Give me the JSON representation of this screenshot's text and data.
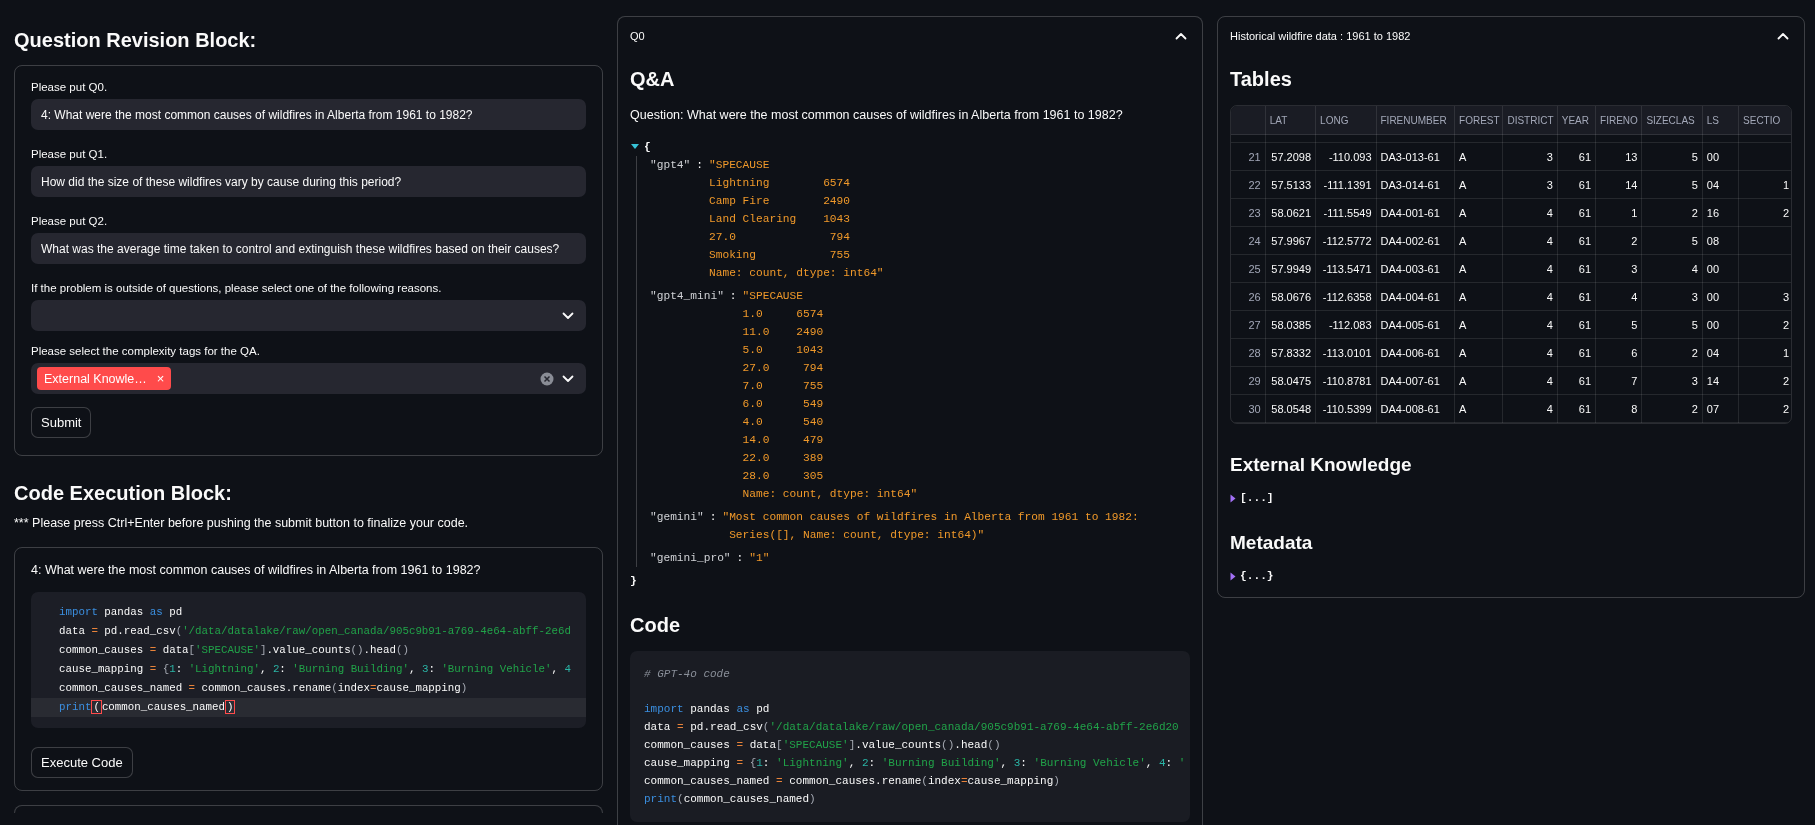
{
  "question_revision": {
    "heading": "Question Revision Block:",
    "questions": [
      {
        "label": "Please put Q0.",
        "value": "4: What were the most common causes of wildfires in Alberta from 1961 to 1982?"
      },
      {
        "label": "Please put Q1.",
        "value": "How did the size of these wildfires vary by cause during this period?"
      },
      {
        "label": "Please put Q2.",
        "value": "What was the average time taken to control and extinguish these wildfires based on their causes?"
      }
    ],
    "reason_select": {
      "label": "If the problem is outside of questions, please select one of the following reasons."
    },
    "complexity_tags": {
      "label": "Please select the complexity tags for the QA.",
      "tags": [
        {
          "text": "External Knowle…",
          "remove": "×"
        }
      ]
    },
    "submit_button": "Submit"
  },
  "code_execution": {
    "heading": "Code Execution Block:",
    "note": "*** Please press Ctrl+Enter before pushing the submit button to finalize your code.",
    "question": "4: What were the most common causes of wildfires in Alberta from 1961 to 1982?",
    "code_lines": [
      {
        "active": false,
        "tokens": [
          {
            "kind": "keyword",
            "text": "import"
          },
          {
            "kind": "plain",
            "text": " pandas "
          },
          {
            "kind": "keyword",
            "text": "as"
          },
          {
            "kind": "plain",
            "text": " pd"
          }
        ]
      },
      {
        "active": false,
        "tokens": [
          {
            "kind": "plain",
            "text": "data "
          },
          {
            "kind": "operator",
            "text": "="
          },
          {
            "kind": "plain",
            "text": " pd.read_csv"
          },
          {
            "kind": "punct",
            "text": "("
          },
          {
            "kind": "string",
            "text": "'/data/datalake/raw/open_canada/905c9b91-a769-4e64-abff-2e6d"
          }
        ]
      },
      {
        "active": false,
        "tokens": [
          {
            "kind": "plain",
            "text": "common_causes "
          },
          {
            "kind": "operator",
            "text": "="
          },
          {
            "kind": "plain",
            "text": " data"
          },
          {
            "kind": "punct",
            "text": "["
          },
          {
            "kind": "string",
            "text": "'SPECAUSE'"
          },
          {
            "kind": "punct",
            "text": "]"
          },
          {
            "kind": "plain",
            "text": ".value_counts"
          },
          {
            "kind": "punct",
            "text": "()"
          },
          {
            "kind": "plain",
            "text": ".head"
          },
          {
            "kind": "punct",
            "text": "()"
          }
        ]
      },
      {
        "active": false,
        "tokens": [
          {
            "kind": "plain",
            "text": "cause_mapping "
          },
          {
            "kind": "operator",
            "text": "= "
          },
          {
            "kind": "punct",
            "text": "{"
          },
          {
            "kind": "number",
            "text": "1"
          },
          {
            "kind": "plain",
            "text": ": "
          },
          {
            "kind": "string",
            "text": "'Lightning'"
          },
          {
            "kind": "plain",
            "text": ", "
          },
          {
            "kind": "number",
            "text": "2"
          },
          {
            "kind": "plain",
            "text": ": "
          },
          {
            "kind": "string",
            "text": "'Burning Building'"
          },
          {
            "kind": "plain",
            "text": ", "
          },
          {
            "kind": "number",
            "text": "3"
          },
          {
            "kind": "plain",
            "text": ": "
          },
          {
            "kind": "string",
            "text": "'Burning Vehicle'"
          },
          {
            "kind": "plain",
            "text": ", "
          },
          {
            "kind": "number",
            "text": "4"
          }
        ]
      },
      {
        "active": false,
        "tokens": [
          {
            "kind": "plain",
            "text": "common_causes_named "
          },
          {
            "kind": "operator",
            "text": "="
          },
          {
            "kind": "plain",
            "text": " common_causes.rename"
          },
          {
            "kind": "punct",
            "text": "("
          },
          {
            "kind": "plain",
            "text": "index"
          },
          {
            "kind": "operator",
            "text": "="
          },
          {
            "kind": "plain",
            "text": "cause_mapping"
          },
          {
            "kind": "punct",
            "text": ")"
          }
        ]
      },
      {
        "active": true,
        "tokens": [
          {
            "kind": "keyword",
            "text": "print"
          },
          {
            "kind": "bracket-match",
            "text": "("
          },
          {
            "kind": "plain",
            "text": "common_causes_named"
          },
          {
            "kind": "bracket-match",
            "text": ")"
          }
        ]
      }
    ],
    "execute_button": "Execute Code"
  },
  "qa_panel": {
    "header": "Q0",
    "expanded": true,
    "title": "Q&A",
    "question": "Question: What were the most common causes of wildfires in Alberta from 1961 to 1982?",
    "answers": {
      "expanded": true,
      "open": "{",
      "close": "}",
      "entries": [
        {
          "key": "\"gpt4\"",
          "separator": ":",
          "value": "\"SPECAUSE\nLightning        6574\nCamp Fire        2490\nLand Clearing    1043\n27.0              794\nSmoking           755\nName: count, dtype: int64\""
        },
        {
          "key": "\"gpt4_mini\"",
          "separator": ":",
          "value": "\"SPECAUSE\n1.0     6574\n11.0    2490\n5.0     1043\n27.0     794\n7.0      755\n6.0      549\n4.0      540\n14.0     479\n22.0     389\n28.0     305\nName: count, dtype: int64\""
        },
        {
          "key": "\"gemini\"",
          "separator": ":",
          "value": "\"Most common causes of wildfires in Alberta from 1961 to 1982:\n Series([], Name: count, dtype: int64)\""
        },
        {
          "key": "\"gemini_pro\"",
          "separator": ":",
          "value": "\"1\""
        }
      ]
    },
    "code_title": "Code",
    "code_comment": "# GPT-4o code",
    "code_lines": [
      {
        "tokens": [
          {
            "kind": "keyword",
            "text": "import"
          },
          {
            "kind": "plain",
            "text": " pandas "
          },
          {
            "kind": "keyword",
            "text": "as"
          },
          {
            "kind": "plain",
            "text": " pd"
          }
        ]
      },
      {
        "tokens": [
          {
            "kind": "plain",
            "text": "data "
          },
          {
            "kind": "operator",
            "text": "="
          },
          {
            "kind": "plain",
            "text": " pd.read_csv"
          },
          {
            "kind": "punct",
            "text": "("
          },
          {
            "kind": "string",
            "text": "'/data/datalake/raw/open_canada/905c9b91-a769-4e64-abff-2e6d20"
          }
        ]
      },
      {
        "tokens": [
          {
            "kind": "plain",
            "text": "common_causes "
          },
          {
            "kind": "operator",
            "text": "="
          },
          {
            "kind": "plain",
            "text": " data"
          },
          {
            "kind": "punct",
            "text": "["
          },
          {
            "kind": "string",
            "text": "'SPECAUSE'"
          },
          {
            "kind": "punct",
            "text": "]"
          },
          {
            "kind": "plain",
            "text": ".value_counts"
          },
          {
            "kind": "punct",
            "text": "()"
          },
          {
            "kind": "plain",
            "text": ".head"
          },
          {
            "kind": "punct",
            "text": "()"
          }
        ]
      },
      {
        "tokens": [
          {
            "kind": "plain",
            "text": "cause_mapping "
          },
          {
            "kind": "operator",
            "text": "= "
          },
          {
            "kind": "punct",
            "text": "{"
          },
          {
            "kind": "number",
            "text": "1"
          },
          {
            "kind": "plain",
            "text": ": "
          },
          {
            "kind": "string",
            "text": "'Lightning'"
          },
          {
            "kind": "plain",
            "text": ", "
          },
          {
            "kind": "number",
            "text": "2"
          },
          {
            "kind": "plain",
            "text": ": "
          },
          {
            "kind": "string",
            "text": "'Burning Building'"
          },
          {
            "kind": "plain",
            "text": ", "
          },
          {
            "kind": "number",
            "text": "3"
          },
          {
            "kind": "plain",
            "text": ": "
          },
          {
            "kind": "string",
            "text": "'Burning Vehicle'"
          },
          {
            "kind": "plain",
            "text": ", "
          },
          {
            "kind": "number",
            "text": "4"
          },
          {
            "kind": "plain",
            "text": ": "
          },
          {
            "kind": "string",
            "text": "'"
          }
        ]
      },
      {
        "tokens": [
          {
            "kind": "plain",
            "text": "common_causes_named "
          },
          {
            "kind": "operator",
            "text": "="
          },
          {
            "kind": "plain",
            "text": " common_causes.rename"
          },
          {
            "kind": "punct",
            "text": "("
          },
          {
            "kind": "plain",
            "text": "index"
          },
          {
            "kind": "operator",
            "text": "="
          },
          {
            "kind": "plain",
            "text": "cause_mapping"
          },
          {
            "kind": "punct",
            "text": ")"
          }
        ]
      },
      {
        "tokens": [
          {
            "kind": "keyword",
            "text": "print"
          },
          {
            "kind": "punct",
            "text": "("
          },
          {
            "kind": "plain",
            "text": "common_causes_named"
          },
          {
            "kind": "punct",
            "text": ")"
          }
        ]
      }
    ]
  },
  "data_panel": {
    "header": "Historical wildfire data : 1961 to 1982",
    "expanded": true,
    "tables_title": "Tables",
    "table": {
      "columns": [
        {
          "label": "LAT",
          "kind": "number"
        },
        {
          "label": "LONG",
          "kind": "number"
        },
        {
          "label": "FIRENUMBER",
          "kind": "text"
        },
        {
          "label": "FOREST",
          "kind": "text"
        },
        {
          "label": "DISTRICT",
          "kind": "number"
        },
        {
          "label": "YEAR",
          "kind": "number"
        },
        {
          "label": "FIRENO",
          "kind": "number"
        },
        {
          "label": "SIZECLAS",
          "kind": "number"
        },
        {
          "label": "LS",
          "kind": "text"
        },
        {
          "label": "SECTIO",
          "kind": "number"
        }
      ],
      "rows": [
        {
          "index": "21",
          "cells": [
            "57.2098",
            "-110.093",
            "DA3-013-61",
            "A",
            "3",
            "61",
            "13",
            "5",
            "00",
            null
          ]
        },
        {
          "index": "22",
          "cells": [
            "57.5133",
            "-111.1391",
            "DA3-014-61",
            "A",
            "3",
            "61",
            "14",
            "5",
            "04",
            "1"
          ]
        },
        {
          "index": "23",
          "cells": [
            "58.0621",
            "-111.5549",
            "DA4-001-61",
            "A",
            "4",
            "61",
            "1",
            "2",
            "16",
            "2"
          ]
        },
        {
          "index": "24",
          "cells": [
            "57.9967",
            "-112.5772",
            "DA4-002-61",
            "A",
            "4",
            "61",
            "2",
            "5",
            "08",
            null
          ]
        },
        {
          "index": "25",
          "cells": [
            "57.9949",
            "-113.5471",
            "DA4-003-61",
            "A",
            "4",
            "61",
            "3",
            "4",
            "00",
            null
          ]
        },
        {
          "index": "26",
          "cells": [
            "58.0676",
            "-112.6358",
            "DA4-004-61",
            "A",
            "4",
            "61",
            "4",
            "3",
            "00",
            "3"
          ]
        },
        {
          "index": "27",
          "cells": [
            "58.0385",
            "-112.083",
            "DA4-005-61",
            "A",
            "4",
            "61",
            "5",
            "5",
            "00",
            "2"
          ]
        },
        {
          "index": "28",
          "cells": [
            "57.8332",
            "-113.0101",
            "DA4-006-61",
            "A",
            "4",
            "61",
            "6",
            "2",
            "04",
            "1"
          ]
        },
        {
          "index": "29",
          "cells": [
            "58.0475",
            "-110.8781",
            "DA4-007-61",
            "A",
            "4",
            "61",
            "7",
            "3",
            "14",
            "2"
          ]
        },
        {
          "index": "30",
          "cells": [
            "58.0548",
            "-110.5399",
            "DA4-008-61",
            "A",
            "4",
            "61",
            "8",
            "2",
            "07",
            "2"
          ]
        }
      ]
    },
    "sections": [
      {
        "title": "External Knowledge",
        "viewer": {
          "expanded": false,
          "text": "[...]"
        }
      },
      {
        "title": "Metadata",
        "viewer": {
          "expanded": false,
          "text": "{...}"
        }
      }
    ]
  }
}
